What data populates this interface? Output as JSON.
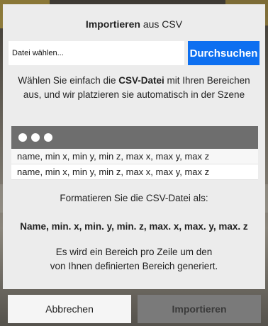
{
  "dialog": {
    "title_bold": "Importieren",
    "title_rest": " aus CSV",
    "file_placeholder": "Datei wählen...",
    "browse_label": "Durchsuchen",
    "description_pre": "Wählen Sie einfach die ",
    "description_bold": "CSV-Datei",
    "description_post": " mit Ihren Bereichen aus, und wir platzieren sie automatisch in der Szene",
    "preview_rows": [
      "name, min x, min y, min z, max x, max y, max z",
      "name, min x, min y, min z, max x, max y, max z"
    ],
    "format_label": "Formatieren Sie die CSV-Datei als:",
    "format_value": "Name, min. x, min. y, min. z, max. x, max. y, max. z",
    "note_line1": "Es wird ein Bereich pro Zeile um den",
    "note_line2": "von Ihnen definierten Bereich generiert.",
    "cancel_label": "Abbrechen",
    "import_label": "Importieren"
  },
  "colors": {
    "browse_button": "#0d6ff0",
    "dialog_bg": "#ececec",
    "import_disabled": "#7a7a7a"
  }
}
